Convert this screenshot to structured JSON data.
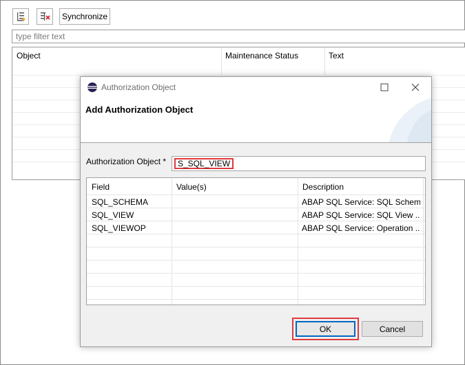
{
  "toolbar": {
    "expand_icon": "add-tree-icon",
    "remove_icon": "remove-tree-icon",
    "synchronize_label": "Synchronize"
  },
  "filter": {
    "placeholder": "type filter text"
  },
  "background_table": {
    "columns": [
      "Object",
      "Maintenance Status",
      "Text"
    ]
  },
  "dialog": {
    "window_title": "Authorization Object",
    "banner_title": "Add Authorization Object",
    "auth_label": "Authorization Object *",
    "auth_value": "S_SQL_VIEW",
    "table": {
      "columns": [
        "Field",
        "Value(s)",
        "Description"
      ],
      "rows": [
        {
          "field": "SQL_SCHEMA",
          "values": "",
          "description": "ABAP SQL Service: SQL Schem..."
        },
        {
          "field": "SQL_VIEW",
          "values": "",
          "description": "ABAP SQL Service: SQL View ..."
        },
        {
          "field": "SQL_VIEWOP",
          "values": "",
          "description": "ABAP SQL Service: Operation ..."
        }
      ]
    },
    "ok_label": "OK",
    "cancel_label": "Cancel"
  },
  "colors": {
    "highlight": "#e0393e",
    "focus": "#0067c0"
  }
}
